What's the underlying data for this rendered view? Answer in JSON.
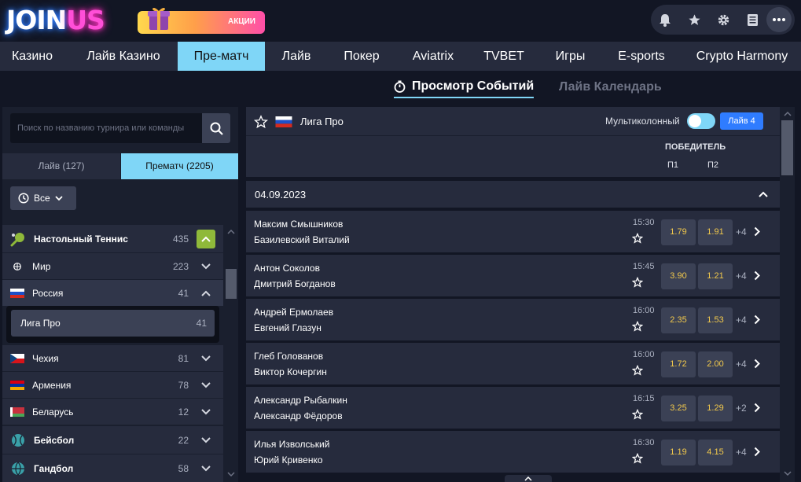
{
  "header": {
    "logo_part1": "JOIN",
    "logo_part2": "US",
    "promo_label": "АКЦИИ",
    "icons": [
      "bell-icon",
      "star-icon",
      "gear-icon",
      "document-icon",
      "more-icon"
    ]
  },
  "nav": {
    "items": [
      "Казино",
      "Лайв Казино",
      "Пре-матч",
      "Лайв",
      "Покер",
      "Aviatrix",
      "TVBET",
      "Игры",
      "E-sports",
      "Crypto Harmony"
    ],
    "active": "Пре-матч"
  },
  "subtabs": {
    "events": "Просмотр Событий",
    "calendar": "Лайв Календарь"
  },
  "sidebar": {
    "search_placeholder": "Поиск по названию турнира или команды",
    "tab_live": "Лайв (127)",
    "tab_prematch": "Прематч (2205)",
    "filter_label": "Все",
    "sports": [
      {
        "name": "Настольный Теннис",
        "count": "435"
      },
      {
        "name": "Бейсбол",
        "count": "22"
      },
      {
        "name": "Гандбол",
        "count": "58"
      }
    ],
    "countries": [
      {
        "name": "Мир",
        "count": "223"
      },
      {
        "name": "Россия",
        "count": "41"
      },
      {
        "name": "Чехия",
        "count": "81"
      },
      {
        "name": "Армения",
        "count": "78"
      },
      {
        "name": "Беларусь",
        "count": "12"
      }
    ],
    "league": {
      "name": "Лига Про",
      "count": "41"
    }
  },
  "main": {
    "league_title": "Лига Про",
    "multicolumn_label": "Мультиколонный",
    "live_button": "Лайв 4",
    "market_title": "ПОБЕДИТЕЛЬ",
    "col_p1": "П1",
    "col_p2": "П2",
    "date": "04.09.2023",
    "matches": [
      {
        "p1": "Максим Смышников",
        "p2": "Базилевский Виталий",
        "time": "15:30",
        "odd1": "1.79",
        "odd2": "1.91",
        "more": "+4"
      },
      {
        "p1": "Антон Соколов",
        "p2": "Дмитрий Богданов",
        "time": "15:45",
        "odd1": "3.90",
        "odd2": "1.21",
        "more": "+4"
      },
      {
        "p1": "Андрей Ермолаев",
        "p2": "Евгений Глазун",
        "time": "16:00",
        "odd1": "2.35",
        "odd2": "1.53",
        "more": "+4"
      },
      {
        "p1": "Глеб Голованов",
        "p2": "Виктор Кочергин",
        "time": "16:00",
        "odd1": "1.72",
        "odd2": "2.00",
        "more": "+4"
      },
      {
        "p1": "Александр Рыбалкин",
        "p2": "Александр Фёдоров",
        "time": "16:15",
        "odd1": "3.25",
        "odd2": "1.29",
        "more": "+2"
      },
      {
        "p1": "Илья Изволський",
        "p2": "Юрий Кривенко",
        "time": "16:30",
        "odd1": "1.19",
        "odd2": "4.15",
        "more": "+4"
      }
    ]
  },
  "colors": {
    "accent": "#7fd6f7",
    "odds": "#f2c94c",
    "panel": "#262b3d",
    "background": "#121624",
    "live_button": "#2f7cff",
    "sport_badge": "#8fb93a"
  }
}
